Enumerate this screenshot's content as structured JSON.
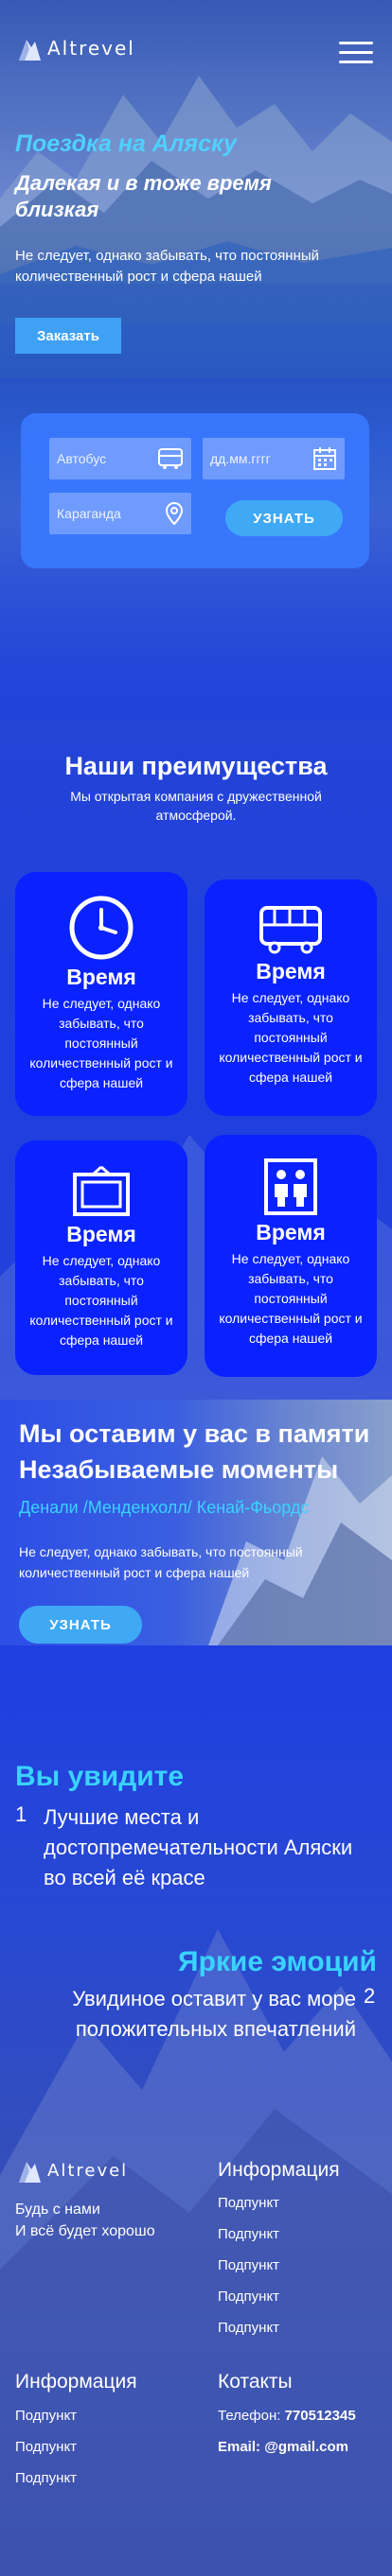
{
  "brand": {
    "logo_text": "Altrevel"
  },
  "hero": {
    "title": "Поездка на Аляску",
    "subtitle": "Далекая и в тоже время близкая",
    "description": "Не следует, однако забывать, что постоянный количественный рост и сфера нашей",
    "order_button": "Заказать"
  },
  "search": {
    "transport_value": "Автобус",
    "date_value": "дд.мм.гггг",
    "city_value": "Караганда",
    "find_button": "УЗНАТЬ"
  },
  "advantages": {
    "title": "Наши преимущества",
    "description": "Мы открытая компания с дружественной атмосферой.",
    "cards": [
      {
        "icon": "clock-icon",
        "title": "Время",
        "text": "Не следует, однако забывать, что постоянный количественный рост и сфера нашей"
      },
      {
        "icon": "bus-icon",
        "title": "Время",
        "text": "Не следует, однако забывать, что постоянный количественный рост и сфера нашей"
      },
      {
        "icon": "picture-frame-icon",
        "title": "Время",
        "text": "Не следует, однако забывать, что постоянный количественный рост и сфера нашей"
      },
      {
        "icon": "elevator-icon",
        "title": "Время",
        "text": "Не следует, однако забывать, что постоянный количественный рост и сфера нашей"
      }
    ]
  },
  "memories": {
    "title": "Мы оставим у вас в памяти Незабываемые моменты",
    "places": "Денали /Менденхолл/ Кенай-Фьордс",
    "description": "Не следует, однако забывать, что постоянный количественный рост и сфера нашей",
    "button": "УЗНАТЬ"
  },
  "you_will_see": {
    "title": "Вы увидите",
    "number": "1",
    "text": "Лучшие места и достопремечательности Аляски во всей её красе"
  },
  "emotions": {
    "title": "Яркие эмоций",
    "number": "2",
    "text": "Увидиное оставит у вас море положительных впечатлений"
  },
  "footer": {
    "logo_text": "Altrevel",
    "tagline_1": "Будь с нами",
    "tagline_2": "И всё будет хорошо",
    "info_col_1": {
      "title": "Информация",
      "items": [
        "Подпункт",
        "Подпункт",
        "Подпункт",
        "Подпункт",
        "Подпункт"
      ]
    },
    "info_col_2": {
      "title": "Информация",
      "items": [
        "Подпункт",
        "Подпункт",
        "Подпункт"
      ]
    },
    "contacts": {
      "title": "Котакты",
      "phone_label": "Телефон:",
      "phone_value": "770512345",
      "email_label": "Email:",
      "email_value": "@gmail.com"
    }
  },
  "colors": {
    "accent_cyan": "#39d3ff",
    "button_blue": "#3fa9f5",
    "card_blue": "#0a22ff",
    "page_blue": "#1f3fc4"
  }
}
